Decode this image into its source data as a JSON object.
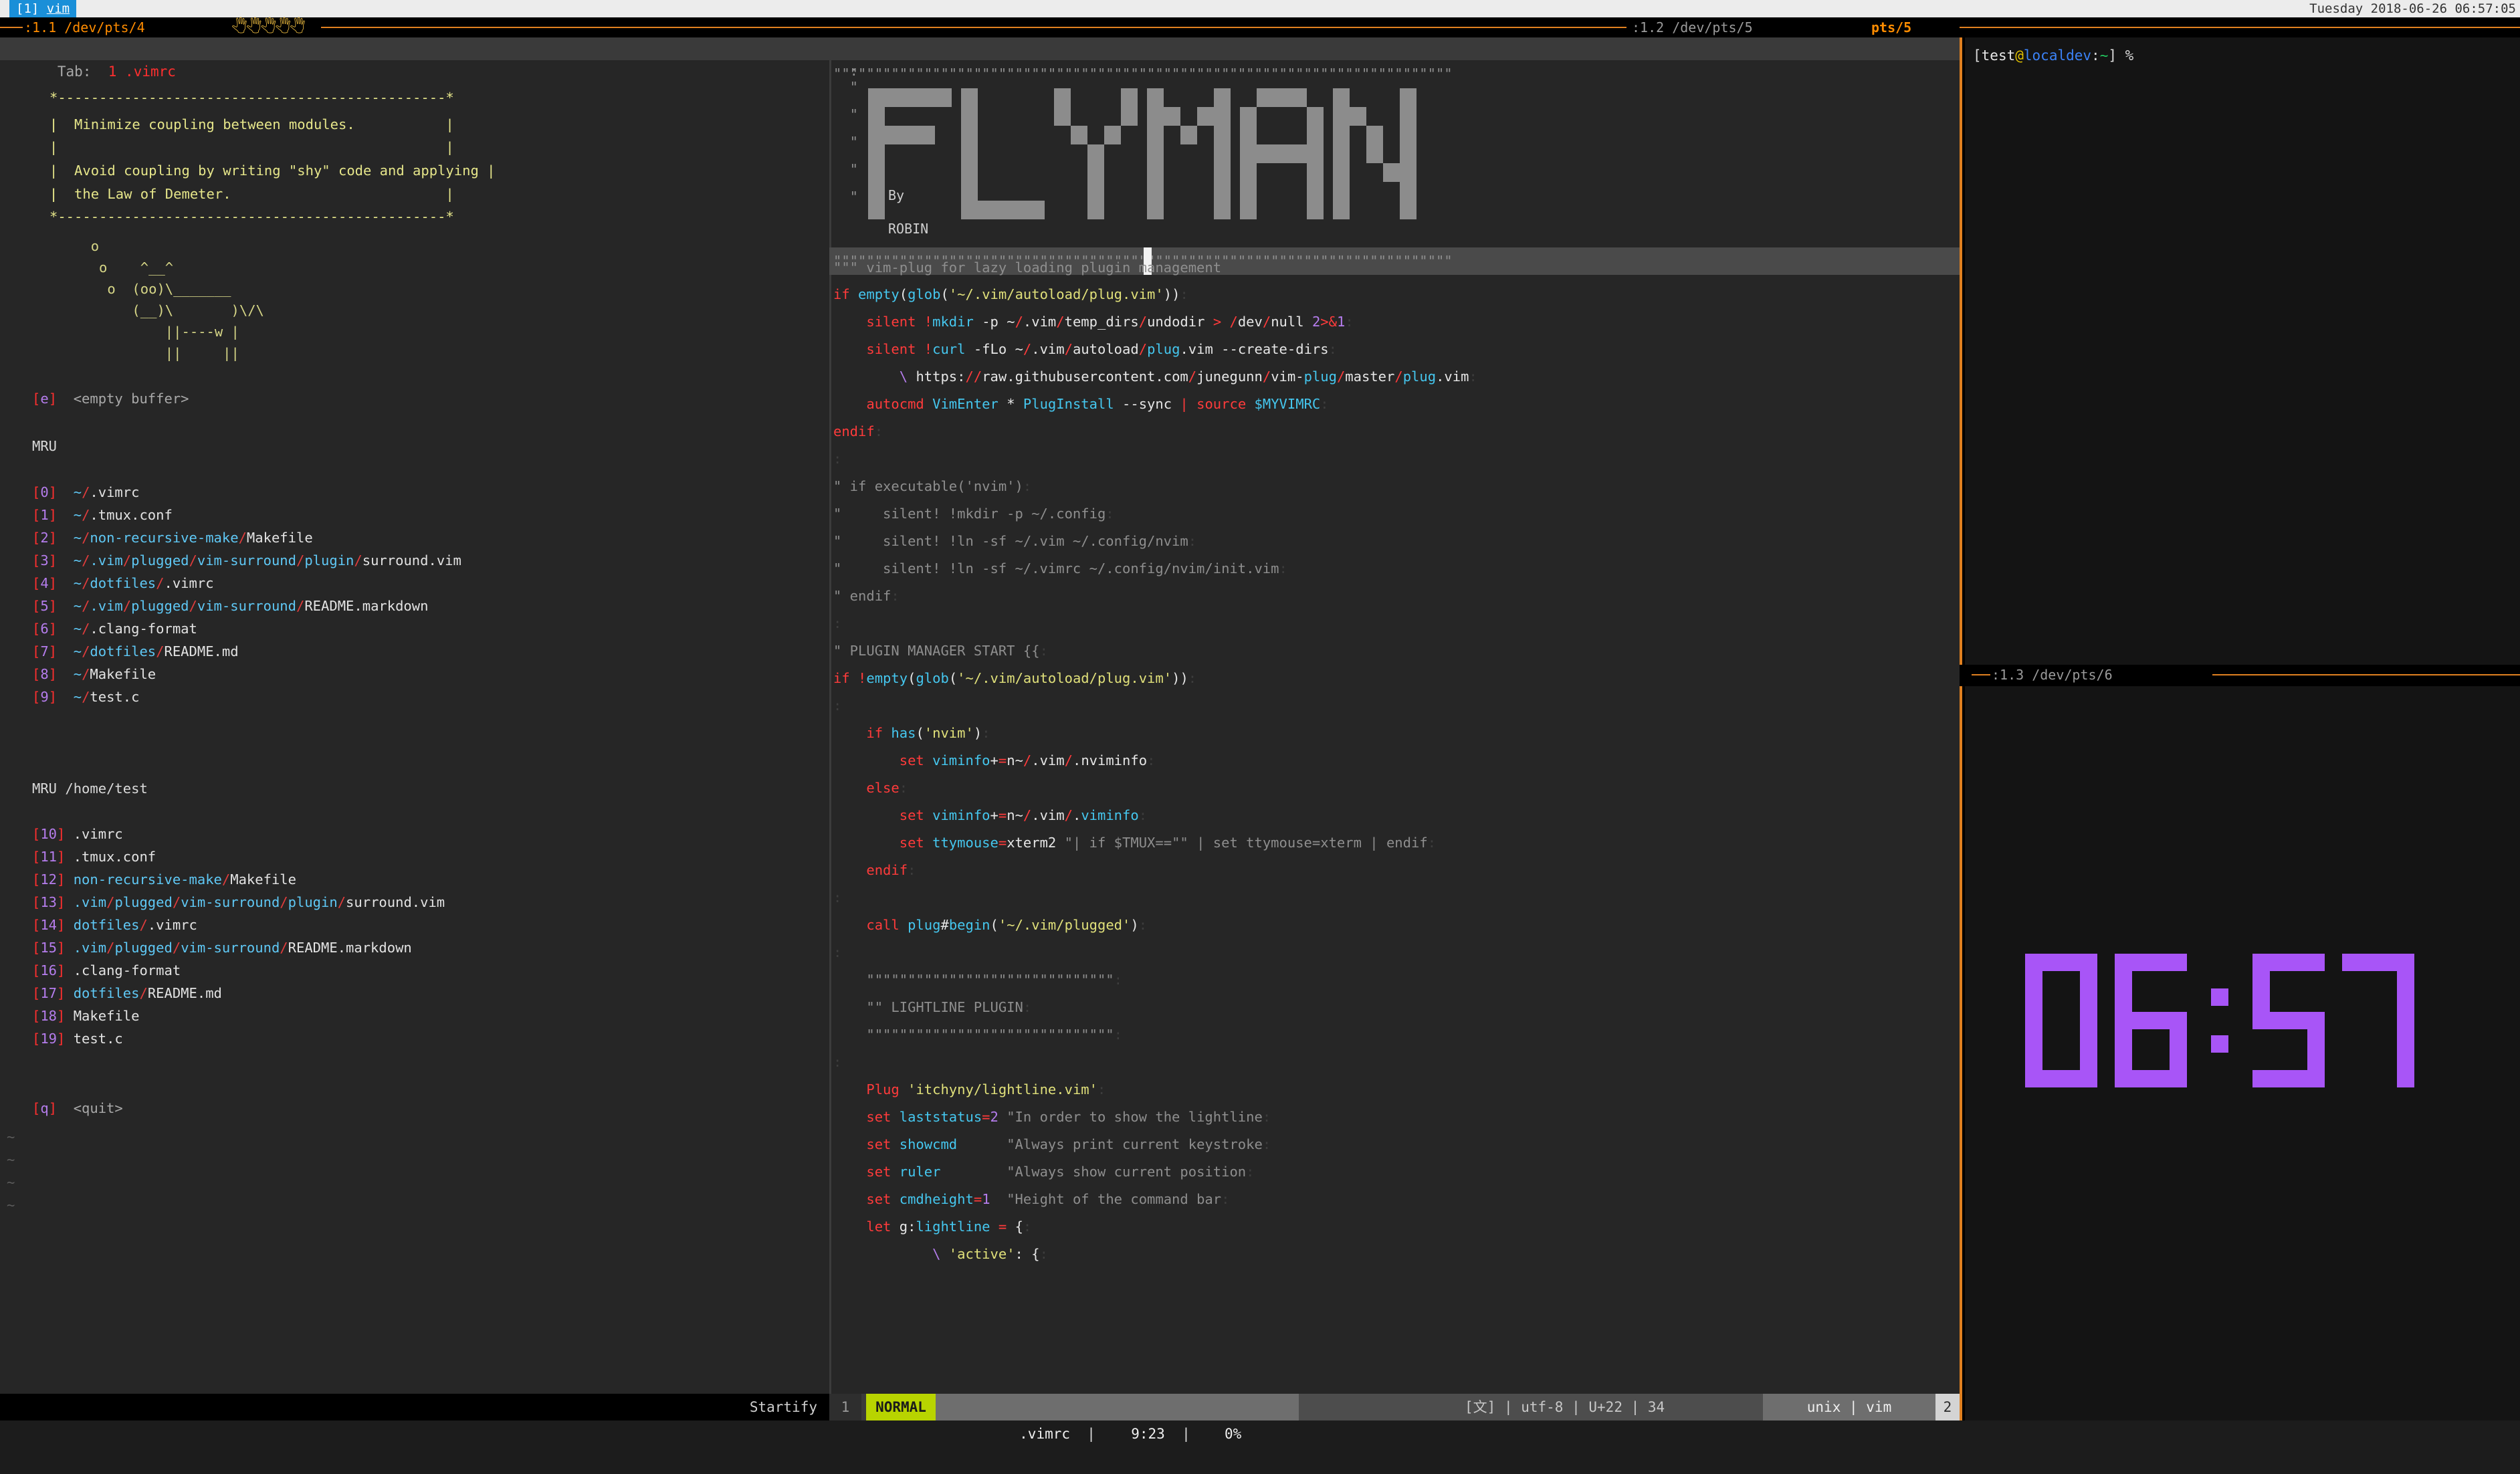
{
  "tmux": {
    "window_label": "[1] ",
    "window_name": "vim",
    "datetime": "Tuesday 2018-06-26 06:57:05",
    "pane_titles": {
      "p1": ":1.1 /dev/pts/4",
      "p1_suffix": "",
      "p2_prefix": ":1.2 /dev/pts/5",
      "p2_active": "pts/5",
      "p3": ":1.3 /dev/pts/6"
    },
    "colors": {
      "accent_orange": "#e08020",
      "window_blue": "#1a8fd8",
      "status_bg": "#ececec"
    }
  },
  "vim": {
    "tabline": {
      "label": "Tab:",
      "number": "1",
      "filename": ".vimrc",
      "cwd": "/home/test"
    },
    "startify": {
      "quote_box": [
        "*-----------------------------------------------*",
        "|                                               |",
        "| Minimize coupling between modules.            |",
        "|                                               |",
        "| Avoid coupling by writing \"shy\" code and applying |",
        "| the Law of Demeter.                           |",
        "*-----------------------------------------------*"
      ],
      "quote_lines": [
        "Minimize coupling between modules.",
        "",
        "Avoid coupling by writing \"shy\" code and applying",
        "the Law of Demeter."
      ],
      "cow_art": [
        "     o",
        "      o    ^__^",
        "       o  (oo)\\_______",
        "          (__)\\       )\\/\\",
        "              ||----w |",
        "              ||     ||"
      ],
      "empty_buffer": {
        "key": "e",
        "label": "<empty buffer>"
      },
      "mru_header": "MRU",
      "mru_cwd_header": "MRU /home/test",
      "quit": {
        "key": "q",
        "label": "<quit>"
      },
      "mru": [
        {
          "key": "0",
          "tilde": "~",
          "dirs": [],
          "file": ".vimrc"
        },
        {
          "key": "1",
          "tilde": "~",
          "dirs": [],
          "file": ".tmux.conf"
        },
        {
          "key": "2",
          "tilde": "~",
          "dirs": [
            "non-recursive-make"
          ],
          "file": "Makefile"
        },
        {
          "key": "3",
          "tilde": "~",
          "dirs": [
            ".vim",
            "plugged",
            "vim-surround",
            "plugin"
          ],
          "file": "surround.vim"
        },
        {
          "key": "4",
          "tilde": "~",
          "dirs": [
            "dotfiles"
          ],
          "file": ".vimrc"
        },
        {
          "key": "5",
          "tilde": "~",
          "dirs": [
            ".vim",
            "plugged",
            "vim-surround"
          ],
          "file": "README.markdown"
        },
        {
          "key": "6",
          "tilde": "~",
          "dirs": [],
          "file": ".clang-format"
        },
        {
          "key": "7",
          "tilde": "~",
          "dirs": [
            "dotfiles"
          ],
          "file": "README.md"
        },
        {
          "key": "8",
          "tilde": "~",
          "dirs": [],
          "file": "Makefile"
        },
        {
          "key": "9",
          "tilde": "~",
          "dirs": [],
          "file": "test.c"
        }
      ],
      "mru_cwd": [
        {
          "key": "10",
          "tilde": "",
          "dirs": [],
          "file": ".vimrc"
        },
        {
          "key": "11",
          "tilde": "",
          "dirs": [],
          "file": ".tmux.conf"
        },
        {
          "key": "12",
          "tilde": "",
          "dirs": [
            "non-recursive-make"
          ],
          "file": "Makefile"
        },
        {
          "key": "13",
          "tilde": "",
          "dirs": [
            ".vim",
            "plugged",
            "vim-surround",
            "plugin"
          ],
          "file": "surround.vim"
        },
        {
          "key": "14",
          "tilde": "",
          "dirs": [
            "dotfiles"
          ],
          "file": ".vimrc"
        },
        {
          "key": "15",
          "tilde": "",
          "dirs": [
            ".vim",
            "plugged",
            "vim-surround"
          ],
          "file": "README.markdown"
        },
        {
          "key": "16",
          "tilde": "",
          "dirs": [],
          "file": ".clang-format"
        },
        {
          "key": "17",
          "tilde": "",
          "dirs": [
            "dotfiles"
          ],
          "file": "README.md"
        },
        {
          "key": "18",
          "tilde": "",
          "dirs": [],
          "file": "Makefile"
        },
        {
          "key": "19",
          "tilde": "",
          "dirs": [],
          "file": "test.c"
        }
      ],
      "eol_tildes": [
        "~",
        "~",
        "~",
        "~"
      ]
    },
    "buffer": {
      "banner_title": "FLYMAN",
      "banner_by": "By",
      "banner_author": "ROBIN",
      "banner_quote_char": "\"",
      "rule_line": "\"\"\"\"\"\"\"\"\"\"\"\"\"\"\"\"\"\"\"\"\"\"\"\"\"\"\"\"\"\"\"\"\"\"\"\"\"\"\"\"\"\"\"\"\"\"\"\"\"\"\"\"\"\"\"\"\"\"\"\"\"\"\"\"\"\"\"\"\"\"\"\"\"\"\"",
      "header_comment": "\"\"\" vim-plug for lazy loading plugin management",
      "code_lines": [
        "if empty(glob('~/.vim/autoload/plug.vim'))",
        "    silent !mkdir -p ~/.vim/temp_dirs/undodir > /dev/null 2>&1",
        "    silent !curl -fLo ~/.vim/autoload/plug.vim --create-dirs",
        "        \\ https://raw.githubusercontent.com/junegunn/vim-plug/master/plug.vim",
        "    autocmd VimEnter * PlugInstall --sync | source $MYVIMRC",
        "endif",
        "",
        "\" if executable('nvim')",
        "\"     silent! !mkdir -p ~/.config",
        "\"     silent! !ln -sf ~/.vim ~/.config/nvim",
        "\"     silent! !ln -sf ~/.vimrc ~/.config/nvim/init.vim",
        "\" endif",
        "",
        "\" PLUGIN MANAGER START {{",
        "if !empty(glob('~/.vim/autoload/plug.vim'))",
        "",
        "    if has('nvim')",
        "        set viminfo+=n~/.vim/.nviminfo",
        "    else",
        "        set viminfo+=n~/.vim/.viminfo",
        "        set ttymouse=xterm2 \"| if $TMUX==\"\" | set ttymouse=xterm | endif",
        "    endif",
        "",
        "    call plug#begin('~/.vim/plugged')",
        "",
        "    \"\"\"\"\"\"\"\"\"\"\"\"\"\"\"\"\"\"\"\"\"\"\"\"\"\"\"\"\"\"",
        "    \"\" LIGHTLINE PLUGIN",
        "    \"\"\"\"\"\"\"\"\"\"\"\"\"\"\"\"\"\"\"\"\"\"\"\"\"\"\"\"\"\"",
        "",
        "    Plug 'itchyny/lightline.vim'",
        "    set laststatus=2 \"In order to show the lightline",
        "    set showcmd      \"Always print current keystroke",
        "    set ruler        \"Always show current position",
        "    set cmdheight=1  \"Height of the command bar",
        "    let g:lightline = {",
        "            \\ 'active': {"
      ]
    },
    "statusline": {
      "left_filetype": "Startify",
      "window_number": "1",
      "mode": "NORMAL",
      "filename": ".vimrc",
      "lineinfo": "9:23",
      "percent": "0%",
      "charmode": "[文]",
      "encoding": "utf-8",
      "codepoint": "U+22",
      "charcode": "34",
      "fileformat": "unix",
      "filetype": "vim",
      "tabcount": "2"
    }
  },
  "terminal": {
    "prompt_open": "[",
    "user": "test",
    "at": "@",
    "host": "localdev",
    "colon": ":",
    "path": "~",
    "prompt_close": "] ",
    "sigil": "%"
  },
  "clock": {
    "time": "06:57",
    "hours": "06",
    "minutes": "57",
    "color": "#a855f7"
  }
}
